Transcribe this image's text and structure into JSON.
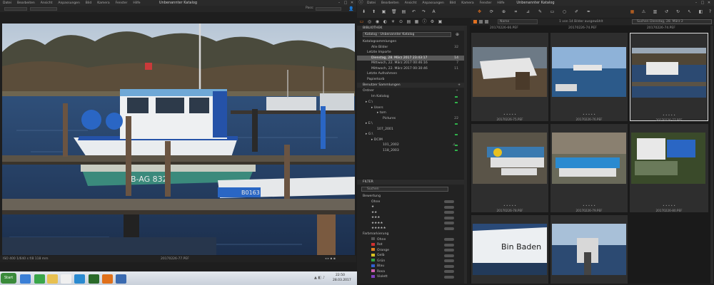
{
  "left_window": {
    "menu": [
      "Datei",
      "Bearbeiten",
      "Ansicht",
      "Anpassungen",
      "Bild",
      "Kamera",
      "Fenster",
      "Hilfe"
    ],
    "title": "Unbenannter Katalog",
    "pass_label": "Pass:",
    "status_exif": "ISO 400  1/640 s  f/8 118 mm",
    "status_filename": "20170226-77.PEF"
  },
  "taskbar": {
    "start_label": "Start",
    "time": "22:50",
    "date": "28.03.2017"
  },
  "right_window": {
    "menu": [
      "Datei",
      "Bearbeiten",
      "Ansicht",
      "Anpassungen",
      "Bild",
      "Kamera",
      "Fenster",
      "Hilfe"
    ],
    "title": "Unbenannter Katalog",
    "sort_value": "Name",
    "selection_info": "1 von 14 Bilder ausgewählt",
    "search_placeholder": "Suchen Dienstag, 28. März 2",
    "library": {
      "header": "BIBLIOTHEK",
      "catalog_select": "Katalog - Unbenannter Katalog",
      "catalog_collections_header": "Katalogsammlungen",
      "all_images_label": "Alle Bilder",
      "all_images_count": "32",
      "last_imports_label": "Letzte Importe",
      "imports": [
        {
          "label": "Dienstag, 28. März 2017 23:43:17",
          "count": "14"
        },
        {
          "label": "Mittwoch, 22. März 2017 00:46:16",
          "count": "7"
        },
        {
          "label": "Mittwoch, 22. März 2017 00:30:46",
          "count": "11"
        }
      ],
      "last_captures_label": "Letzte Aufnahmen",
      "trash_label": "Papierkorb",
      "user_collections_header": "Benutzer Sammlungen",
      "folders_header": "Ordner",
      "in_catalog_label": "Im Katalog",
      "tree": [
        {
          "label": "C:\\",
          "count": ""
        },
        {
          "label": "Users",
          "count": ""
        },
        {
          "label": "tom",
          "count": ""
        },
        {
          "label": "Pictures",
          "count": "22"
        },
        {
          "label": "E:\\",
          "count": ""
        },
        {
          "label": "107_2001",
          "count": ""
        },
        {
          "label": "G:\\",
          "count": ""
        },
        {
          "label": "DCIM",
          "count": ""
        },
        {
          "label": "101_2002",
          "count": ""
        },
        {
          "label": "118_2003",
          "count": ""
        }
      ]
    },
    "filter": {
      "header": "FILTER",
      "search_placeholder": "Suchen",
      "rating_header": "Bewertung",
      "ratings": [
        "Ohne",
        "★",
        "★★",
        "★★★",
        "★★★★",
        "★★★★★"
      ],
      "color_header": "Farbmarkierung",
      "colors": [
        {
          "label": "Ohne",
          "color": "#555555"
        },
        {
          "label": "Rot",
          "color": "#d03030"
        },
        {
          "label": "Orange",
          "color": "#e08020"
        },
        {
          "label": "Gelb",
          "color": "#d8c020"
        },
        {
          "label": "Grün",
          "color": "#30a040"
        },
        {
          "label": "Blau",
          "color": "#3060d0"
        },
        {
          "label": "Rosa",
          "color": "#d060b0"
        },
        {
          "label": "Violett",
          "color": "#8040c0"
        }
      ]
    },
    "thumbnails": {
      "top_captions": [
        "20170226-66.PEF",
        "20170226-74.PEF",
        "20170226-74.PEF"
      ],
      "row1_captions": [
        "20170226-75.PEF",
        "20170226-76.PEF",
        "20170226-77.PEF"
      ],
      "row2_captions": [
        "20170226-78.PEF",
        "20170226-79.PEF",
        "20170226-80.PEF"
      ],
      "thumb_text_bin_baden": "Bin Baden"
    }
  },
  "photo_text": {
    "boat_reg": "B-AG 832",
    "boat_reg2": "B0163"
  },
  "colors": {
    "accent_green": "#2fb24a",
    "selection_gray": "#5a5a5a",
    "accent_orange": "#e07020"
  }
}
